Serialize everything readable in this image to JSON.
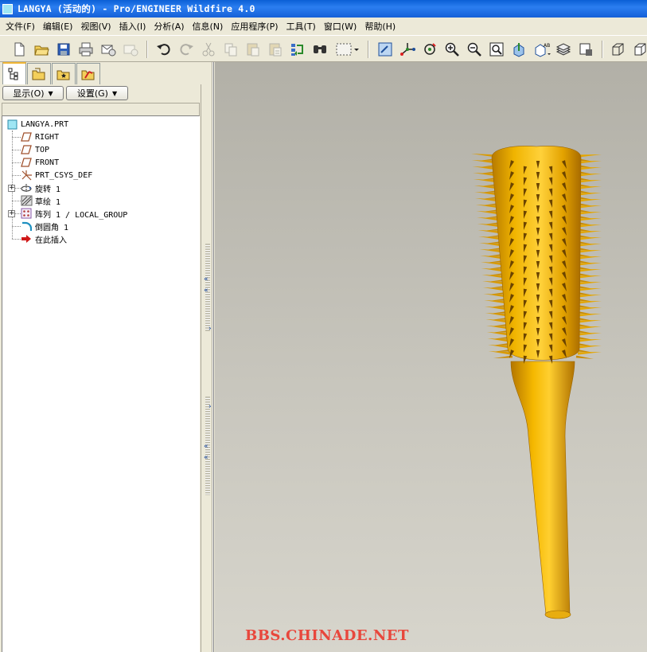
{
  "window": {
    "title": "LANGYA (活动的) - Pro/ENGINEER Wildfire 4.0"
  },
  "menubar": {
    "items": [
      "文件(F)",
      "编辑(E)",
      "视图(V)",
      "插入(I)",
      "分析(A)",
      "信息(N)",
      "应用程序(P)",
      "工具(T)",
      "窗口(W)",
      "帮助(H)"
    ]
  },
  "toolbar": {
    "icons": [
      "new-file-icon",
      "open-folder-icon",
      "save-icon",
      "print-icon",
      "send-mail-icon",
      "disabled-mail-icon",
      "undo-icon",
      "redo-icon",
      "cut-icon",
      "copy-icon",
      "paste-icon",
      "paste-special-icon",
      "regenerate-icon",
      "search-icon",
      "select-box-icon",
      "repaint-icon",
      "spin-center-icon",
      "orient-mode-icon",
      "zoom-in-icon",
      "zoom-out-icon",
      "refit-icon",
      "reorient-icon",
      "saved-views-icon",
      "layers-icon",
      "view-manager-icon",
      "wireframe-icon",
      "hidden-line-icon"
    ]
  },
  "model_tree": {
    "tabs": [
      "model-tree-tab-icon",
      "folder-browser-tab-icon",
      "favorites-tab-icon",
      "connections-tab-icon"
    ],
    "show_label": "显示(O)",
    "settings_label": "设置(G)",
    "items": [
      {
        "label": "LANGYA.PRT",
        "icon": "part-icon"
      },
      {
        "label": "RIGHT",
        "icon": "datum-plane-icon"
      },
      {
        "label": "TOP",
        "icon": "datum-plane-icon"
      },
      {
        "label": "FRONT",
        "icon": "datum-plane-icon"
      },
      {
        "label": "PRT_CSYS_DEF",
        "icon": "csys-icon"
      },
      {
        "label": "旋转 1",
        "icon": "revolve-icon"
      },
      {
        "label": "草绘 1",
        "icon": "sketch-icon"
      },
      {
        "label": "阵列 1 / LOCAL_GROUP",
        "icon": "pattern-icon"
      },
      {
        "label": "倒圆角 1",
        "icon": "round-icon"
      },
      {
        "label": "在此插入",
        "icon": "insert-here-arrow-icon"
      }
    ]
  },
  "viewport": {
    "watermark": "BBS.CHINADE.NET",
    "model_color": "#e0a000",
    "background_top": "#b2b0a7",
    "background_bottom": "#d7d5cc"
  }
}
